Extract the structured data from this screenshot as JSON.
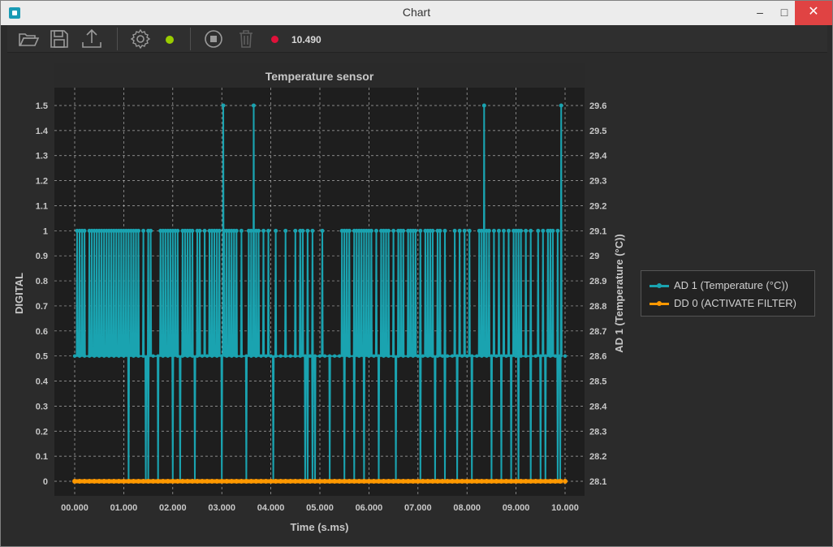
{
  "window": {
    "title": "Chart",
    "min_label": "–",
    "max_label": "□",
    "close_label": "✕"
  },
  "toolbar": {
    "icons": [
      "folder-open-icon",
      "save-icon",
      "upload-icon",
      "gear-icon",
      "status-dot-icon",
      "stop-icon",
      "trash-icon",
      "record-dot-icon"
    ],
    "status_color": "#9acd00",
    "record_color": "#e0113a",
    "counter": "10.490"
  },
  "colors": {
    "series_ad": "#1aa3b0",
    "series_dd": "#ff9800",
    "plot_bg": "#1e1e1e",
    "text": "#c8c8c8"
  },
  "chart_data": {
    "type": "line",
    "title": "Temperature sensor",
    "xlabel": "Time (s.ms)",
    "ylabel_left": "DIGITAL",
    "ylabel_right": "AD 1 (Temperature (°C))",
    "x_ticks": [
      "00.000",
      "01.000",
      "02.000",
      "03.000",
      "04.000",
      "05.000",
      "06.000",
      "07.000",
      "08.000",
      "09.000",
      "10.000"
    ],
    "y_left_ticks": [
      "0",
      "0.1",
      "0.2",
      "0.3",
      "0.4",
      "0.5",
      "0.6",
      "0.7",
      "0.8",
      "0.9",
      "1",
      "1.1",
      "1.2",
      "1.3",
      "1.4",
      "1.5"
    ],
    "y_right_ticks": [
      "28.1",
      "28.2",
      "28.3",
      "28.4",
      "28.5",
      "28.6",
      "28.7",
      "28.8",
      "28.9",
      "29",
      "29.1",
      "29.2",
      "29.3",
      "29.4",
      "29.5",
      "29.6"
    ],
    "xlim": [
      0,
      10
    ],
    "ylim_left": [
      0,
      1.5
    ],
    "ylim_right": [
      28.1,
      29.6
    ],
    "grid": true,
    "legend_position": "right",
    "series": [
      {
        "name": "AD 1 (Temperature (°C))",
        "axis": "right",
        "baseline": 28.6,
        "high_times": [
          0.05,
          0.1,
          0.15,
          0.2,
          0.3,
          0.35,
          0.4,
          0.45,
          0.5,
          0.55,
          0.6,
          0.65,
          0.7,
          0.75,
          0.8,
          0.85,
          0.9,
          0.95,
          1.0,
          1.05,
          1.1,
          1.15,
          1.2,
          1.25,
          1.3,
          1.4,
          1.5,
          1.55,
          1.75,
          1.8,
          1.85,
          1.9,
          1.95,
          2.0,
          2.05,
          2.1,
          2.2,
          2.25,
          2.3,
          2.35,
          2.4,
          2.5,
          2.55,
          2.65,
          2.75,
          2.8,
          2.85,
          2.9,
          2.95,
          3.05,
          3.1,
          3.15,
          3.2,
          3.25,
          3.3,
          3.4,
          3.55,
          3.6,
          3.7,
          3.75,
          3.85,
          3.95,
          4.1,
          4.3,
          4.5,
          4.6,
          4.65,
          4.75,
          4.85,
          5.05,
          5.45,
          5.5,
          5.55,
          5.6,
          5.7,
          5.75,
          5.8,
          5.85,
          5.9,
          5.95,
          6.0,
          6.05,
          6.15,
          6.25,
          6.3,
          6.35,
          6.4,
          6.5,
          6.6,
          6.65,
          6.7,
          6.8,
          6.85,
          6.9,
          6.95,
          7.05,
          7.15,
          7.2,
          7.25,
          7.3,
          7.4,
          7.45,
          7.55,
          7.75,
          7.85,
          7.95,
          8.05,
          8.25,
          8.3,
          8.4,
          8.45,
          8.55,
          8.65,
          8.75,
          8.85,
          8.95,
          9.0,
          9.05,
          9.1,
          9.2,
          9.3,
          9.45,
          9.55,
          9.65,
          9.7,
          9.75,
          9.85
        ],
        "peak_times": [
          3.03,
          3.65,
          8.35,
          9.92
        ],
        "peak_value": 29.6,
        "low_times": [
          1.1,
          1.45,
          1.5,
          1.7,
          2.0,
          2.15,
          2.45,
          3.0,
          3.5,
          4.05,
          4.7,
          4.75,
          4.85,
          4.9,
          5.2,
          5.5,
          5.7,
          5.9,
          6.2,
          6.55,
          7.05,
          7.35,
          7.55,
          7.8,
          8.1,
          8.5,
          8.7,
          8.9,
          9.05,
          9.3,
          9.5,
          9.6,
          9.85,
          9.9
        ],
        "low_value": 28.1
      },
      {
        "name": "DD 0 (ACTIVATE FILTER)",
        "axis": "left",
        "constant": 0
      }
    ]
  }
}
